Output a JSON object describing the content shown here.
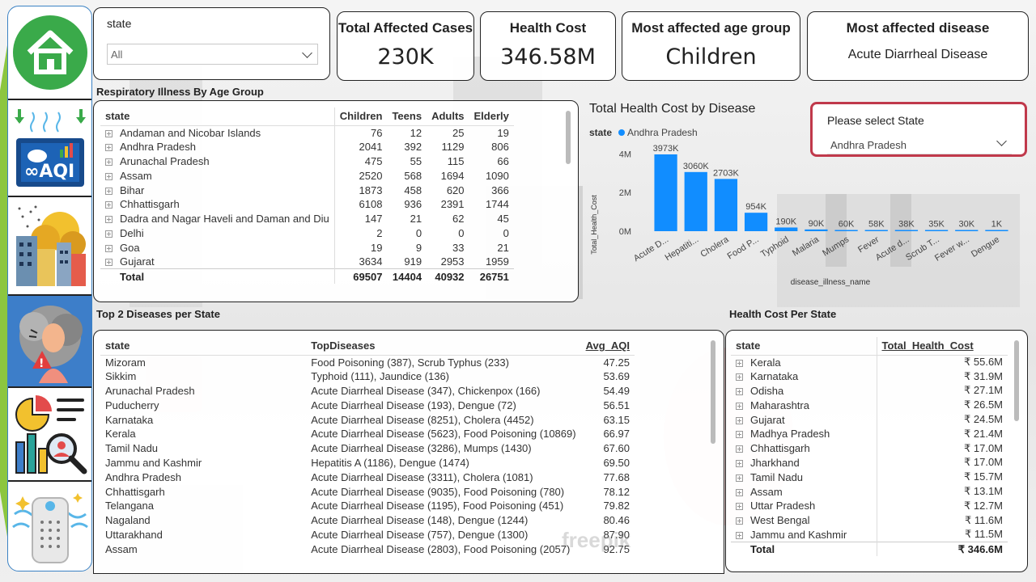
{
  "sidebar": {
    "items": [
      {
        "icon": "home-icon",
        "label": "Home"
      },
      {
        "icon": "aqi-icon",
        "label": "AQI"
      },
      {
        "icon": "pollution-city-icon",
        "label": "Pollution"
      },
      {
        "icon": "respiratory-illness-icon",
        "label": "Illness"
      },
      {
        "icon": "analytics-report-icon",
        "label": "Analytics"
      },
      {
        "icon": "air-purifier-icon",
        "label": "Purifier"
      }
    ]
  },
  "filter": {
    "label": "state",
    "value": "All"
  },
  "kpis": [
    {
      "title": "Total Affected Cases",
      "value": "230K"
    },
    {
      "title": "Health Cost",
      "value": "346.58M"
    },
    {
      "title": "Most affected age group",
      "value": "Children"
    },
    {
      "title": "Most affected disease",
      "value": "Acute Diarrheal Disease"
    }
  ],
  "respiratory": {
    "title": "Respiratory Illness  By Age Group",
    "columns": [
      "state",
      "Children",
      "Teens",
      "Adults",
      "Elderly"
    ],
    "rows": [
      [
        "Andaman and Nicobar Islands",
        "76",
        "12",
        "25",
        "19"
      ],
      [
        "Andhra Pradesh",
        "2041",
        "392",
        "1129",
        "806"
      ],
      [
        "Arunachal Pradesh",
        "475",
        "55",
        "115",
        "66"
      ],
      [
        "Assam",
        "2520",
        "568",
        "1694",
        "1090"
      ],
      [
        "Bihar",
        "1873",
        "458",
        "620",
        "366"
      ],
      [
        "Chhattisgarh",
        "6108",
        "936",
        "2391",
        "1744"
      ],
      [
        "Dadra and Nagar Haveli and Daman and Diu",
        "147",
        "21",
        "62",
        "45"
      ],
      [
        "Delhi",
        "2",
        "0",
        "0",
        "0"
      ],
      [
        "Goa",
        "19",
        "9",
        "33",
        "21"
      ],
      [
        "Gujarat",
        "3634",
        "919",
        "2953",
        "1959"
      ]
    ],
    "total": [
      "Total",
      "69507",
      "14404",
      "40932",
      "26751"
    ]
  },
  "chart_title": "Total Health Cost by Disease",
  "chart_data": {
    "type": "bar",
    "title": "Total Health Cost by Disease",
    "legend_label": "state",
    "legend": [
      "Andhra Pradesh"
    ],
    "xlabel": "disease_illness_name",
    "ylabel": "Total_Health_Cost",
    "categories": [
      "Acute D...",
      "Hepatiti...",
      "Cholera",
      "Food P...",
      "Typhoid",
      "Malaria",
      "Mumps",
      "Fever",
      "Acute d...",
      "Scrub T...",
      "Fever w...",
      "Dengue"
    ],
    "values": [
      3973000,
      3060000,
      2703000,
      954000,
      190000,
      90000,
      60000,
      58000,
      38000,
      35000,
      30000,
      1000
    ],
    "data_labels": [
      "3973K",
      "3060K",
      "2703K",
      "954K",
      "190K",
      "90K",
      "60K",
      "58K",
      "38K",
      "35K",
      "30K",
      "1K"
    ],
    "yticks": [
      "0M",
      "2M",
      "4M"
    ],
    "ytick_values": [
      0,
      2000000,
      4000000
    ],
    "ylim": [
      0,
      4600000
    ],
    "color": "#118dff"
  },
  "state_select": {
    "label": "Please select State",
    "value": "Andhra Pradesh",
    "border_color": "#c0394b"
  },
  "top_diseases": {
    "title": "Top 2 Diseases per State",
    "columns": [
      "state",
      "TopDiseases",
      "Avg_AQI"
    ],
    "rows": [
      [
        "Mizoram",
        "Food Poisoning (387), Scrub Typhus (233)",
        "47.25"
      ],
      [
        "Sikkim",
        "Typhoid (111), Jaundice (136)",
        "53.69"
      ],
      [
        "Arunachal Pradesh",
        "Acute Diarrheal Disease (347), Chickenpox (166)",
        "54.49"
      ],
      [
        "Puducherry",
        "Acute Diarrheal Disease (193), Dengue (72)",
        "56.51"
      ],
      [
        "Karnataka",
        "Acute Diarrheal Disease (8251), Cholera (4452)",
        "63.15"
      ],
      [
        "Kerala",
        "Acute Diarrheal Disease (5623), Food Poisoning (10869)",
        "66.97"
      ],
      [
        "Tamil Nadu",
        "Acute Diarrheal Disease (3286), Mumps (1430)",
        "67.60"
      ],
      [
        "Jammu and Kashmir",
        "Hepatitis A (1186), Dengue (1474)",
        "69.50"
      ],
      [
        "Andhra Pradesh",
        "Acute Diarrheal Disease (3311), Cholera (1081)",
        "77.68"
      ],
      [
        "Chhattisgarh",
        "Acute Diarrheal Disease (9035), Food Poisoning (780)",
        "78.12"
      ],
      [
        "Telangana",
        "Acute Diarrheal Disease (1195), Food Poisoning (451)",
        "79.82"
      ],
      [
        "Nagaland",
        "Acute Diarrheal Disease (148), Dengue (1244)",
        "80.46"
      ],
      [
        "Uttarakhand",
        "Acute Diarrheal Disease (757), Dengue (1300)",
        "87.90"
      ],
      [
        "Assam",
        "Acute Diarrheal Disease (2803), Food Poisoning (2057)",
        "92.75"
      ]
    ]
  },
  "health_cost": {
    "title": "Health Cost Per State",
    "columns": [
      "state",
      "Total_Health_Cost"
    ],
    "rows": [
      [
        "Kerala",
        "₹ 55.6M"
      ],
      [
        "Karnataka",
        "₹ 31.9M"
      ],
      [
        "Odisha",
        "₹ 27.1M"
      ],
      [
        "Maharashtra",
        "₹ 26.5M"
      ],
      [
        "Gujarat",
        "₹ 24.5M"
      ],
      [
        "Madhya Pradesh",
        "₹ 21.4M"
      ],
      [
        "Chhattisgarh",
        "₹ 17.0M"
      ],
      [
        "Jharkhand",
        "₹ 17.0M"
      ],
      [
        "Tamil Nadu",
        "₹ 15.7M"
      ],
      [
        "Assam",
        "₹ 13.1M"
      ],
      [
        "Uttar Pradesh",
        "₹ 12.7M"
      ],
      [
        "West Bengal",
        "₹ 11.6M"
      ],
      [
        "Jammu and Kashmir",
        "₹ 11.5M"
      ]
    ],
    "total": [
      "Total",
      "₹ 346.6M"
    ]
  },
  "watermark": "freepik"
}
